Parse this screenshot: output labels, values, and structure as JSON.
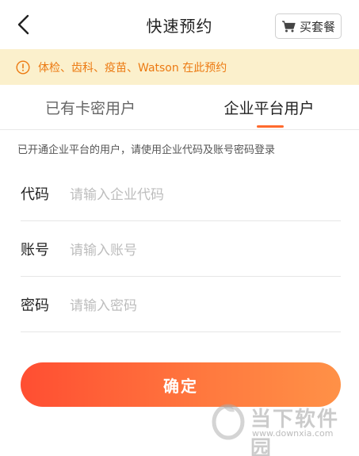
{
  "header": {
    "title": "快速预约",
    "back_icon": "back-arrow-icon",
    "buy_button": {
      "label": "买套餐",
      "icon": "cart-icon"
    }
  },
  "notice": {
    "icon": "info-icon",
    "text": "体检、齿科、疫苗、Watson 在此预约",
    "color": "#ec7a12",
    "background": "#fbf0cc"
  },
  "tabs": [
    {
      "label": "已有卡密用户",
      "active": false
    },
    {
      "label": "企业平台用户",
      "active": true
    }
  ],
  "hint": "已开通企业平台的用户，请使用企业代码及账号密码登录",
  "form": {
    "code": {
      "label": "代码",
      "placeholder": "请输入企业代码"
    },
    "account": {
      "label": "账号",
      "placeholder": "请输入账号"
    },
    "password": {
      "label": "密码",
      "placeholder": "请输入密码"
    }
  },
  "confirm_label": "确定",
  "accent_color": "#ff6a2d",
  "watermark": {
    "text": "当下软件园",
    "url": "www.downxia.com"
  }
}
